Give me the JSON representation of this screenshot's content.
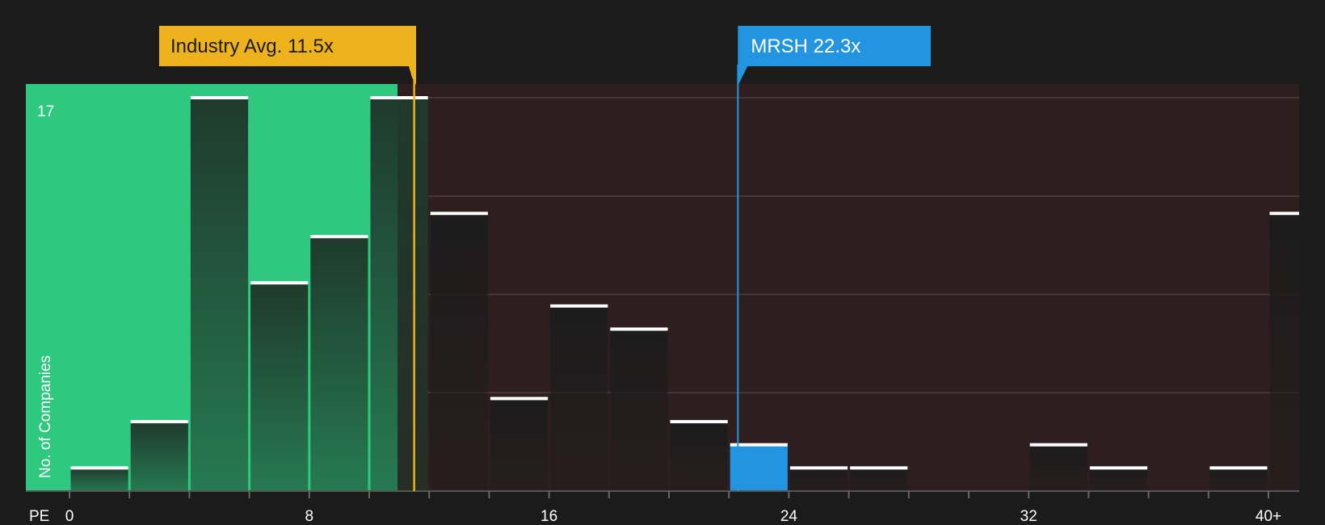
{
  "chart_data": {
    "type": "bar",
    "x_axis_label": "PE",
    "y_axis_label": "No. of Companies",
    "x_ticks": [
      "0",
      "8",
      "16",
      "24",
      "32",
      "40+"
    ],
    "y_max_label": "17",
    "ylim": [
      0,
      17
    ],
    "bin_width": 2,
    "bins": [
      {
        "start": 0,
        "value": 1
      },
      {
        "start": 2,
        "value": 3
      },
      {
        "start": 4,
        "value": 17
      },
      {
        "start": 6,
        "value": 9
      },
      {
        "start": 8,
        "value": 11
      },
      {
        "start": 10,
        "value": 17
      },
      {
        "start": 12,
        "value": 12
      },
      {
        "start": 14,
        "value": 4
      },
      {
        "start": 16,
        "value": 8
      },
      {
        "start": 18,
        "value": 7
      },
      {
        "start": 20,
        "value": 3
      },
      {
        "start": 22,
        "value": 2
      },
      {
        "start": 24,
        "value": 1
      },
      {
        "start": 26,
        "value": 1
      },
      {
        "start": 28,
        "value": 0
      },
      {
        "start": 30,
        "value": 0
      },
      {
        "start": 32,
        "value": 2
      },
      {
        "start": 34,
        "value": 1
      },
      {
        "start": 36,
        "value": 0
      },
      {
        "start": 38,
        "value": 1
      },
      {
        "start": 40,
        "value": 12
      }
    ],
    "industry_avg": {
      "label": "Industry Avg. 11.5x",
      "value": 11.5
    },
    "company": {
      "label": "MRSH 22.3x",
      "value": 22.3
    },
    "colors": {
      "background": "#1b1b1b",
      "undervalued_zone": "#2ec87f",
      "overvalued_zone": "#2f1e1f",
      "bar_fill": "#1f1f1f",
      "bar_top": "#ffffff",
      "highlight_bar": "#2394e0",
      "industry_callout": "#eeb21c",
      "company_callout": "#2394e0"
    }
  }
}
